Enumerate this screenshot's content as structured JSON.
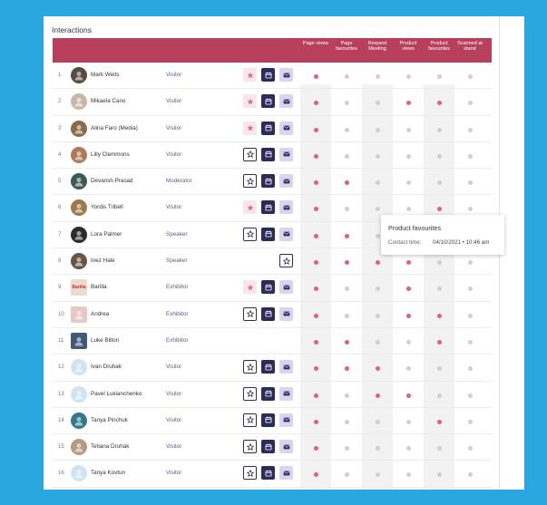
{
  "section_title": "Interactions",
  "columns": [
    "Page views",
    "Page favourites",
    "Request Meeting",
    "Product views",
    "Product favourites",
    "Scanned at stand"
  ],
  "rows": [
    {
      "num": "1",
      "name": "Mark Weits",
      "role": "Visitor",
      "star": "soft",
      "cal": true,
      "mail": true,
      "dots": [
        1,
        0,
        0,
        0,
        0,
        0
      ],
      "avatar": "#5a4a42",
      "avatar_text": ""
    },
    {
      "num": "2",
      "name": "Mikaela Cano",
      "role": "Visitor",
      "star": "soft",
      "cal": true,
      "mail": true,
      "dots": [
        1,
        0,
        0,
        1,
        1,
        0
      ],
      "avatar": "#c9b8a8",
      "avatar_text": ""
    },
    {
      "num": "3",
      "name": "Alina Faro (Media)",
      "role": "Visitor",
      "star": "soft",
      "cal": true,
      "mail": true,
      "dots": [
        1,
        0,
        0,
        0,
        0,
        0
      ],
      "avatar": "#8a6a4c",
      "avatar_text": ""
    },
    {
      "num": "4",
      "name": "Lilly Clemmons",
      "role": "Visitor",
      "star": "outline",
      "cal": true,
      "mail": true,
      "dots": [
        1,
        0,
        0,
        0,
        0,
        0
      ],
      "avatar": "#b07a5a",
      "avatar_text": ""
    },
    {
      "num": "5",
      "name": "Devansh Prasad",
      "role": "Moderator",
      "star": "outline",
      "cal": true,
      "mail": true,
      "dots": [
        1,
        1,
        0,
        0,
        0,
        0
      ],
      "avatar": "#3f5a52",
      "avatar_text": ""
    },
    {
      "num": "6",
      "name": "Yordis Tribell",
      "role": "Visitor",
      "star": "soft",
      "cal": true,
      "mail": true,
      "dots": [
        1,
        0,
        0,
        0,
        1,
        0
      ],
      "avatar": "#9b7a4a",
      "avatar_text": ""
    },
    {
      "num": "7",
      "name": "Lora Palmer",
      "role": "Speaker",
      "star": "outline",
      "cal": true,
      "mail": true,
      "dots": [
        1,
        1,
        0,
        0,
        0,
        0
      ],
      "avatar": "#2b2b2b",
      "avatar_text": ""
    },
    {
      "num": "8",
      "name": "Inez Hale",
      "role": "Speaker",
      "star": "outline-single",
      "cal": false,
      "mail": false,
      "dots": [
        1,
        1,
        1,
        1,
        0,
        0
      ],
      "avatar": "#6b5347",
      "avatar_text": ""
    },
    {
      "num": "9",
      "name": "Barilla",
      "role": "Exhibitor",
      "star": "soft",
      "cal": true,
      "mail": true,
      "dots": [
        1,
        0,
        0,
        1,
        0,
        0
      ],
      "avatar": "#ecd9cf",
      "avatar_text": "Barilla",
      "square": true
    },
    {
      "num": "10",
      "name": "Andrea",
      "role": "Exhibitor",
      "star": "outline",
      "cal": true,
      "mail": true,
      "dots": [
        1,
        0,
        0,
        1,
        1,
        0
      ],
      "avatar": "#e6c8c4",
      "avatar_text": "",
      "square": true
    },
    {
      "num": "11",
      "name": "Luke Bilton",
      "role": "Exhibitor",
      "star": "none",
      "cal": false,
      "mail": false,
      "dots": [
        1,
        1,
        0,
        0,
        1,
        0
      ],
      "avatar": "#415a78",
      "avatar_text": "",
      "square": true
    },
    {
      "num": "12",
      "name": "Ivan Druhak",
      "role": "Visitor",
      "star": "outline",
      "cal": true,
      "mail": true,
      "dots": [
        1,
        1,
        1,
        0,
        0,
        0
      ],
      "avatar": "#cfe3f3",
      "avatar_text": ""
    },
    {
      "num": "13",
      "name": "Pavel Lukianchenko",
      "role": "Visitor",
      "star": "outline",
      "cal": true,
      "mail": true,
      "dots": [
        1,
        0,
        1,
        1,
        0,
        0
      ],
      "avatar": "#cfe3f3",
      "avatar_text": ""
    },
    {
      "num": "14",
      "name": "Tanya Pinchuk",
      "role": "Visitor",
      "star": "outline",
      "cal": true,
      "mail": true,
      "dots": [
        1,
        0,
        0,
        0,
        1,
        0
      ],
      "avatar": "#2f7a8a",
      "avatar_text": ""
    },
    {
      "num": "15",
      "name": "Tetiana Druhak",
      "role": "Visitor",
      "star": "outline",
      "cal": true,
      "mail": true,
      "dots": [
        1,
        0,
        0,
        0,
        0,
        0
      ],
      "avatar": "#b89a80",
      "avatar_text": ""
    },
    {
      "num": "16",
      "name": "Tanya Kovtun",
      "role": "Visitor",
      "star": "outline",
      "cal": true,
      "mail": true,
      "dots": [
        1,
        0,
        0,
        0,
        0,
        0
      ],
      "avatar": "#cfe3f3",
      "avatar_text": ""
    }
  ],
  "tooltip": {
    "title": "Product favourites",
    "label": "Contact time:",
    "value": "04/10/2021 • 10:46 am"
  },
  "colors": {
    "accent": "#b8405c",
    "dot_on": "#e65b86",
    "dot_off": "#cfcfcf",
    "navy": "#2d2b5c"
  },
  "icons": {
    "star": "star-icon",
    "calendar": "calendar-icon",
    "mail": "mail-icon"
  }
}
